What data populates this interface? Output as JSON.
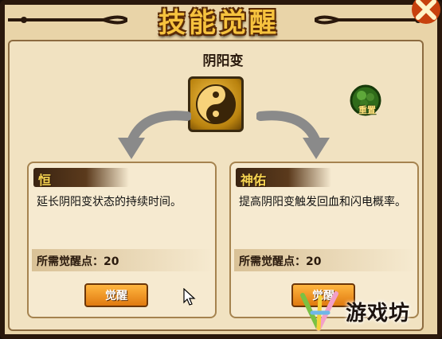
{
  "window": {
    "title": "技能觉醒"
  },
  "skill": {
    "name": "阴阳变",
    "icon": "yin-yang-icon",
    "reset_label": "重置"
  },
  "options": [
    {
      "name": "恒",
      "description": "延长阴阳变状态的持续时间。",
      "points_label": "所需觉醒点：20",
      "button_label": "觉醒"
    },
    {
      "name": "神佑",
      "description": "提高阴阳变触发回血和闪电概率。",
      "points_label": "所需觉醒点：20",
      "button_label": "觉醒"
    }
  ],
  "watermark": {
    "text": "游戏坊"
  },
  "colors": {
    "frame": "#2a180c",
    "parchment": "#f1e2c1",
    "title_gold": "#f6c23e",
    "button_orange": "#e07a10",
    "reset_green": "#2f6b1a"
  }
}
